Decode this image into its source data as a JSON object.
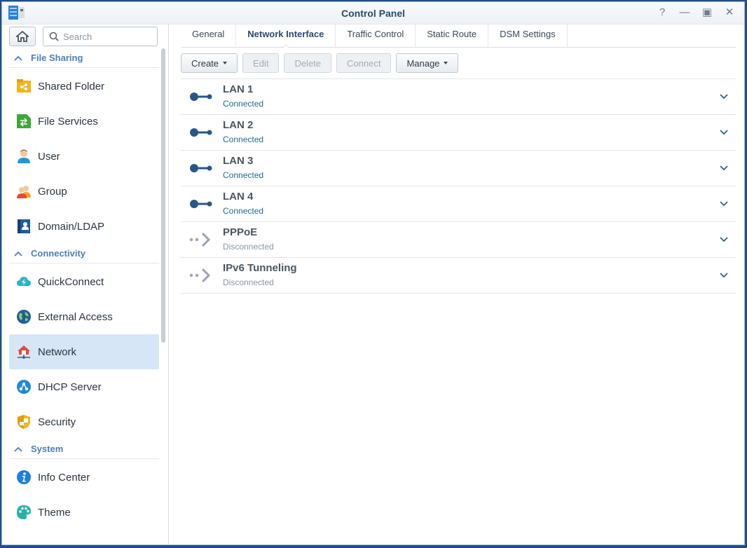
{
  "window": {
    "title": "Control Panel"
  },
  "window_controls": [
    "help",
    "minimize",
    "maximize",
    "close"
  ],
  "sidebar": {
    "search_placeholder": "Search",
    "sections": [
      {
        "title": "File Sharing",
        "items": [
          {
            "label": "Shared Folder",
            "icon": "shared-folder-icon"
          },
          {
            "label": "File Services",
            "icon": "file-services-icon"
          },
          {
            "label": "User",
            "icon": "user-icon"
          },
          {
            "label": "Group",
            "icon": "group-icon"
          },
          {
            "label": "Domain/LDAP",
            "icon": "domain-ldap-icon"
          }
        ]
      },
      {
        "title": "Connectivity",
        "items": [
          {
            "label": "QuickConnect",
            "icon": "quickconnect-icon"
          },
          {
            "label": "External Access",
            "icon": "external-access-icon"
          },
          {
            "label": "Network",
            "icon": "network-icon",
            "active": true
          },
          {
            "label": "DHCP Server",
            "icon": "dhcp-server-icon"
          },
          {
            "label": "Security",
            "icon": "security-icon"
          }
        ]
      },
      {
        "title": "System",
        "items": [
          {
            "label": "Info Center",
            "icon": "info-center-icon"
          },
          {
            "label": "Theme",
            "icon": "theme-icon"
          }
        ]
      }
    ]
  },
  "tabs": [
    {
      "label": "General"
    },
    {
      "label": "Network Interface",
      "active": true
    },
    {
      "label": "Traffic Control"
    },
    {
      "label": "Static Route"
    },
    {
      "label": "DSM Settings"
    }
  ],
  "toolbar": {
    "create": "Create",
    "edit": "Edit",
    "delete": "Delete",
    "connect": "Connect",
    "manage": "Manage"
  },
  "interfaces": [
    {
      "name": "LAN 1",
      "status": "Connected",
      "connected": true
    },
    {
      "name": "LAN 2",
      "status": "Connected",
      "connected": true
    },
    {
      "name": "LAN 3",
      "status": "Connected",
      "connected": true
    },
    {
      "name": "LAN 4",
      "status": "Connected",
      "connected": true
    },
    {
      "name": "PPPoE",
      "status": "Disconnected",
      "connected": false
    },
    {
      "name": "IPv6 Tunneling",
      "status": "Disconnected",
      "connected": false
    }
  ],
  "colors": {
    "accent": "#4a80b3",
    "active_bg": "#d6e6f6",
    "connected": "#1f6a90",
    "lan_icon": "#285789"
  }
}
